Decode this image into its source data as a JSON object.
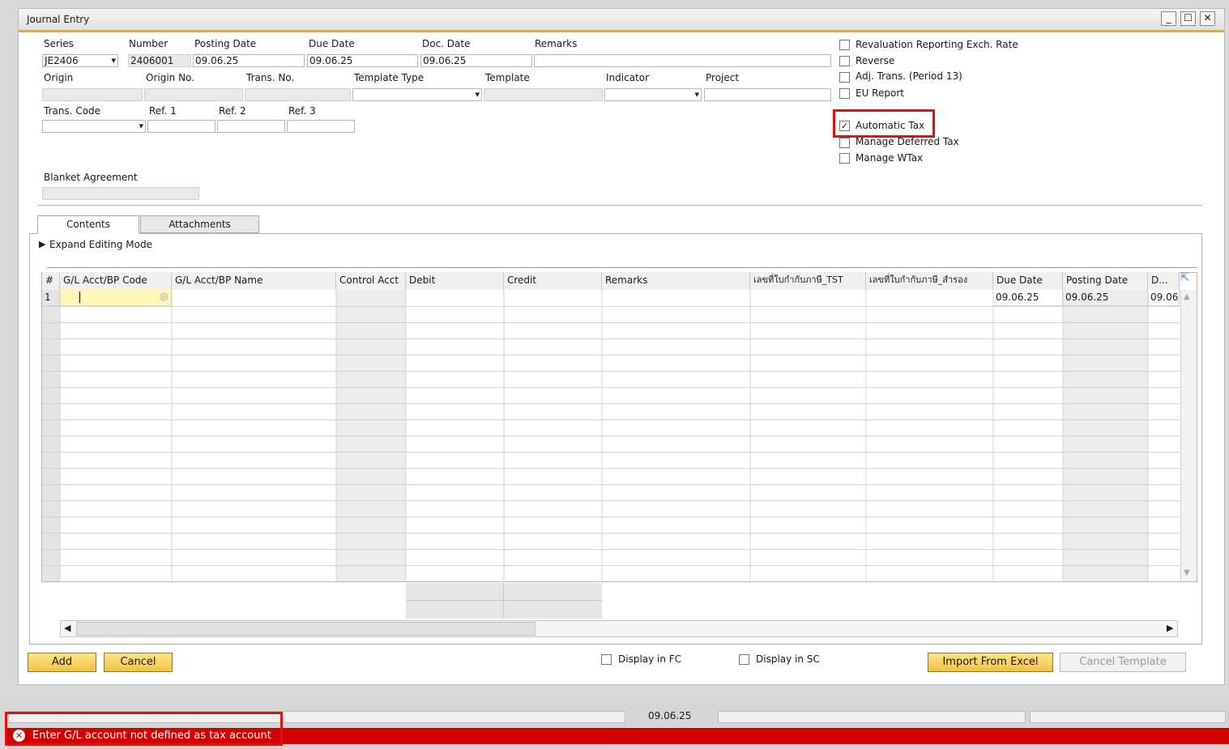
{
  "window": {
    "title": "Journal Entry",
    "min": "_",
    "max": "☐",
    "close": "✕"
  },
  "header": {
    "series_label": "Series",
    "series_value": "JE2406",
    "number_label": "Number",
    "number_value": "2406001",
    "posting_date_label": "Posting Date",
    "posting_date_value": "09.06.25",
    "due_date_label": "Due Date",
    "due_date_value": "09.06.25",
    "doc_date_label": "Doc. Date",
    "doc_date_value": "09.06.25",
    "remarks_label": "Remarks",
    "remarks_value": "",
    "origin_label": "Origin",
    "origin_no_label": "Origin No.",
    "trans_no_label": "Trans. No.",
    "template_type_label": "Template Type",
    "template_label": "Template",
    "indicator_label": "Indicator",
    "project_label": "Project",
    "trans_code_label": "Trans. Code",
    "ref1_label": "Ref. 1",
    "ref2_label": "Ref. 2",
    "ref3_label": "Ref. 3",
    "blanket_label": "Blanket Agreement"
  },
  "checkboxes": {
    "revaluation": "Revaluation Reporting Exch. Rate",
    "reverse": "Reverse",
    "adj_trans": "Adj. Trans. (Period 13)",
    "eu_report": "EU Report",
    "automatic_tax": "Automatic Tax",
    "automatic_tax_checked": "✓",
    "deferred_tax": "Manage Deferred Tax",
    "wtax": "Manage WTax"
  },
  "tabs": {
    "contents": "Contents",
    "attachments": "Attachments"
  },
  "expand_mode": "Expand Editing Mode",
  "grid": {
    "columns": [
      "#",
      "G/L Acct/BP Code",
      "G/L Acct/BP Name",
      "Control Acct",
      "Debit",
      "Credit",
      "Remarks",
      "เลขที่ใบกำกับภาษี_TST",
      "เลขที่ใบกำกับภาษี_สำรอง",
      "Due Date",
      "Posting Date",
      "D..."
    ],
    "row1": {
      "num": "1",
      "due_date": "09.06.25",
      "posting_date": "09.06.25",
      "d": "09.06"
    }
  },
  "footer": {
    "add": "Add",
    "cancel": "Cancel",
    "display_fc": "Display in FC",
    "display_sc": "Display in SC",
    "import_excel": "Import From Excel",
    "cancel_template": "Cancel Template"
  },
  "status": {
    "date": "09.06.25",
    "error": "Enter G/L account not defined as tax account"
  },
  "colors": {
    "accent": "#f0a81c",
    "error": "#d00000",
    "highlight": "#e01010",
    "active_cell": "#fff6b8"
  }
}
